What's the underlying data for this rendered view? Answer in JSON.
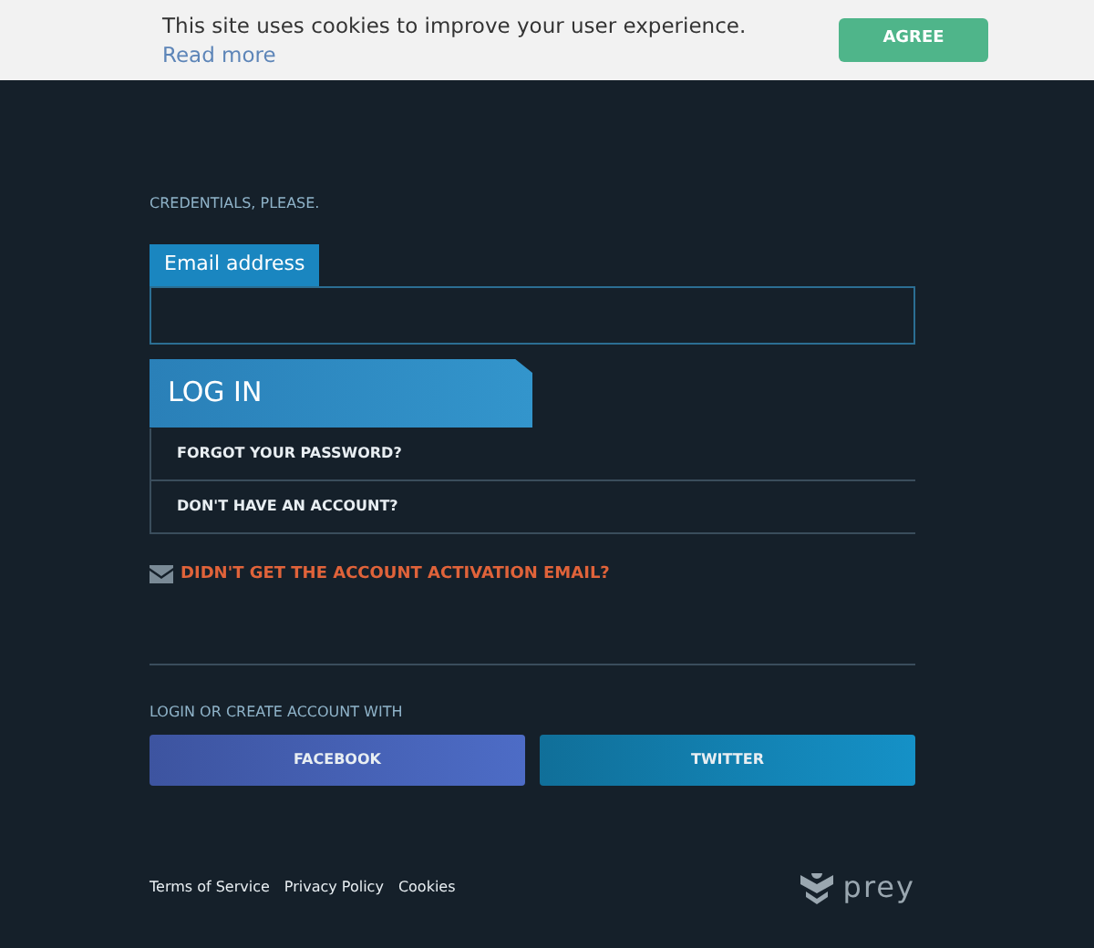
{
  "cookie_bar": {
    "message": "This site uses cookies to improve your user experience.",
    "link": "Read more",
    "button": "AGREE"
  },
  "login": {
    "heading": "CREDENTIALS, PLEASE.",
    "email_label": "Email address",
    "submit": "LOG IN",
    "links": [
      "FORGOT YOUR PASSWORD?",
      "DON'T HAVE AN ACCOUNT?"
    ],
    "activation": "DIDN'T GET THE ACCOUNT ACTIVATION EMAIL?"
  },
  "social": {
    "heading": "LOGIN OR CREATE ACCOUNT WITH",
    "buttons": [
      {
        "label": "FACEBOOK",
        "kind": "facebook"
      },
      {
        "label": "TWITTER",
        "kind": "twitter"
      }
    ]
  },
  "footer": {
    "links": [
      "Terms of Service",
      "Privacy Policy",
      "Cookies"
    ],
    "logo": "prey"
  }
}
